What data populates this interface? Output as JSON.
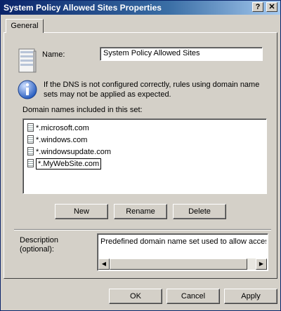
{
  "window": {
    "title": "System Policy Allowed Sites Properties",
    "help_label": "?",
    "close_label": "✕"
  },
  "tabs": [
    {
      "label": "General",
      "selected": true
    }
  ],
  "general": {
    "name_label": "Name:",
    "name_value": "System Policy Allowed Sites",
    "info_text_line1": "If the DNS is not configured correctly, rules using domain name",
    "info_text_line2": "sets may not be applied as expected.",
    "domains_label": "Domain names included in this set:",
    "domains": [
      "*.microsoft.com",
      "*.windows.com",
      "*.windowsupdate.com",
      "*.MyWebSite.com"
    ],
    "new_label": "New",
    "rename_label": "Rename",
    "delete_label": "Delete",
    "description_label_line1": "Description",
    "description_label_line2": "(optional):",
    "description_value": "Predefined domain name set used to allow access"
  },
  "footer": {
    "ok_label": "OK",
    "cancel_label": "Cancel",
    "apply_label": "Apply"
  },
  "icons": {
    "server": "server-icon",
    "info": "info-icon",
    "domain_item": "document-icon"
  }
}
